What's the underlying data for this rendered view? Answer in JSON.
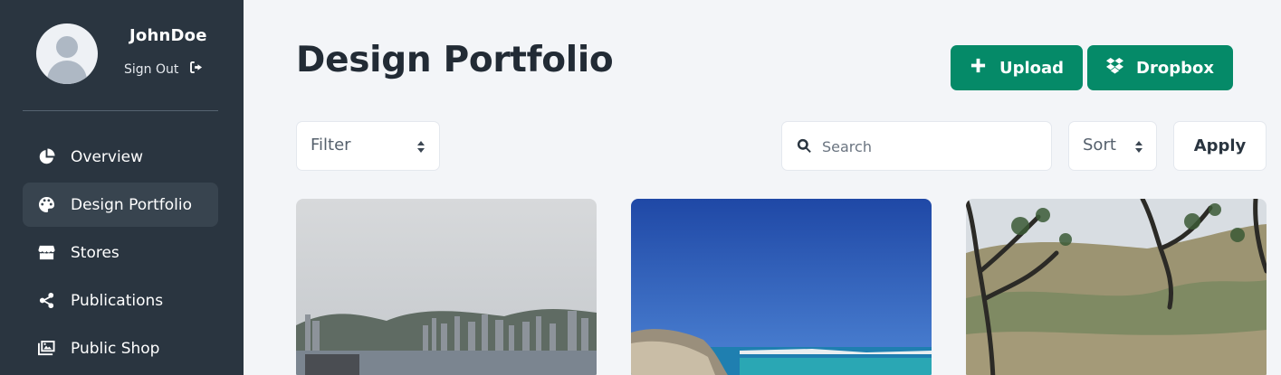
{
  "user": {
    "name": "JohnDoe",
    "signout_label": "Sign Out"
  },
  "sidebar": {
    "items": [
      {
        "label": "Overview",
        "icon": "pie-chart-icon",
        "active": false
      },
      {
        "label": "Design Portfolio",
        "icon": "palette-icon",
        "active": true
      },
      {
        "label": "Stores",
        "icon": "store-icon",
        "active": false
      },
      {
        "label": "Publications",
        "icon": "share-icon",
        "active": false
      },
      {
        "label": "Public Shop",
        "icon": "images-icon",
        "active": false
      }
    ]
  },
  "header": {
    "title": "Design Portfolio",
    "upload_label": "Upload",
    "dropbox_label": "Dropbox"
  },
  "toolbar": {
    "filter_label": "Filter",
    "search_placeholder": "Search",
    "sort_label": "Sort",
    "apply_label": "Apply"
  },
  "colors": {
    "sidebar_bg": "#2a3540",
    "accent": "#058a68",
    "page_bg": "#f3f5f8"
  }
}
